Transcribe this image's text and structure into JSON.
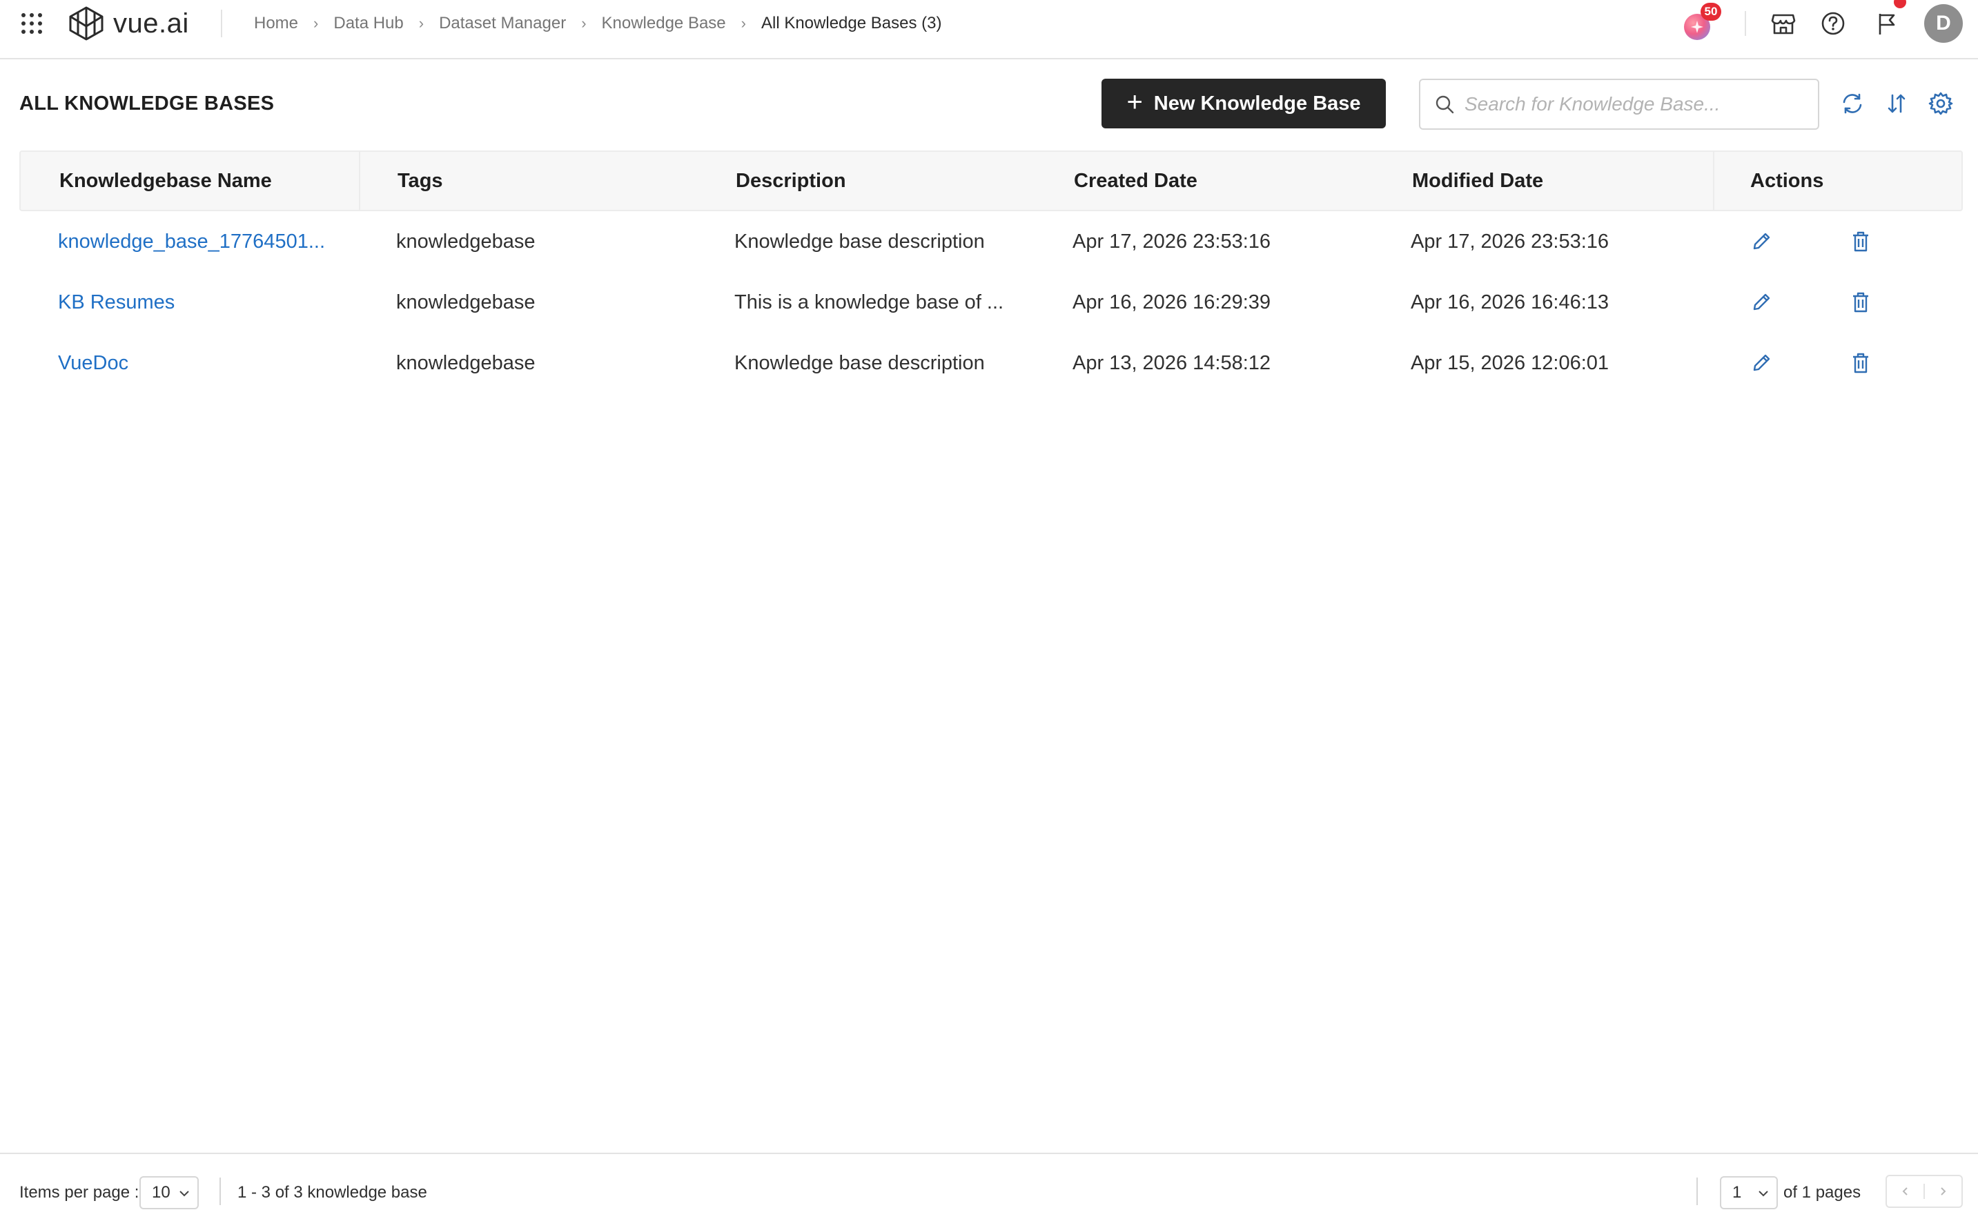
{
  "app": {
    "logo_text": "vue.ai"
  },
  "breadcrumb": {
    "items": [
      "Home",
      "Data Hub",
      "Dataset Manager",
      "Knowledge Base"
    ],
    "current": "All Knowledge Bases (3)"
  },
  "topbar": {
    "ai_badge_count": "50",
    "avatar_initial": "D",
    "icons": [
      "apps-grid-icon",
      "ai-assistant-icon",
      "marketplace-icon",
      "help-icon",
      "announcements-icon"
    ]
  },
  "page": {
    "title": "ALL KNOWLEDGE BASES",
    "new_button_label": "New Knowledge Base",
    "search_placeholder": "Search for Knowledge Base..."
  },
  "table": {
    "columns": [
      "Knowledgebase Name",
      "Tags",
      "Description",
      "Created Date",
      "Modified Date",
      "Actions"
    ],
    "rows": [
      {
        "name": "knowledge_base_17764501...",
        "tags": "knowledgebase",
        "description": "Knowledge base description",
        "created": "Apr 17, 2026 23:53:16",
        "modified": "Apr 17, 2026 23:53:16"
      },
      {
        "name": "KB Resumes",
        "tags": "knowledgebase",
        "description": "This is a knowledge base of ...",
        "created": "Apr 16, 2026 16:29:39",
        "modified": "Apr 16, 2026 16:46:13"
      },
      {
        "name": "VueDoc",
        "tags": "knowledgebase",
        "description": "Knowledge base description",
        "created": "Apr 13, 2026 14:58:12",
        "modified": "Apr 15, 2026 12:06:01"
      }
    ]
  },
  "footer": {
    "items_per_page_label": "Items per page :",
    "items_per_page_value": "10",
    "range_text": "1 - 3 of 3 knowledge base",
    "current_page": "1",
    "of_pages_text": "of 1 pages"
  },
  "colors": {
    "primary_button": "#262626",
    "link": "#1f6fc5",
    "badge": "#e52b35"
  }
}
